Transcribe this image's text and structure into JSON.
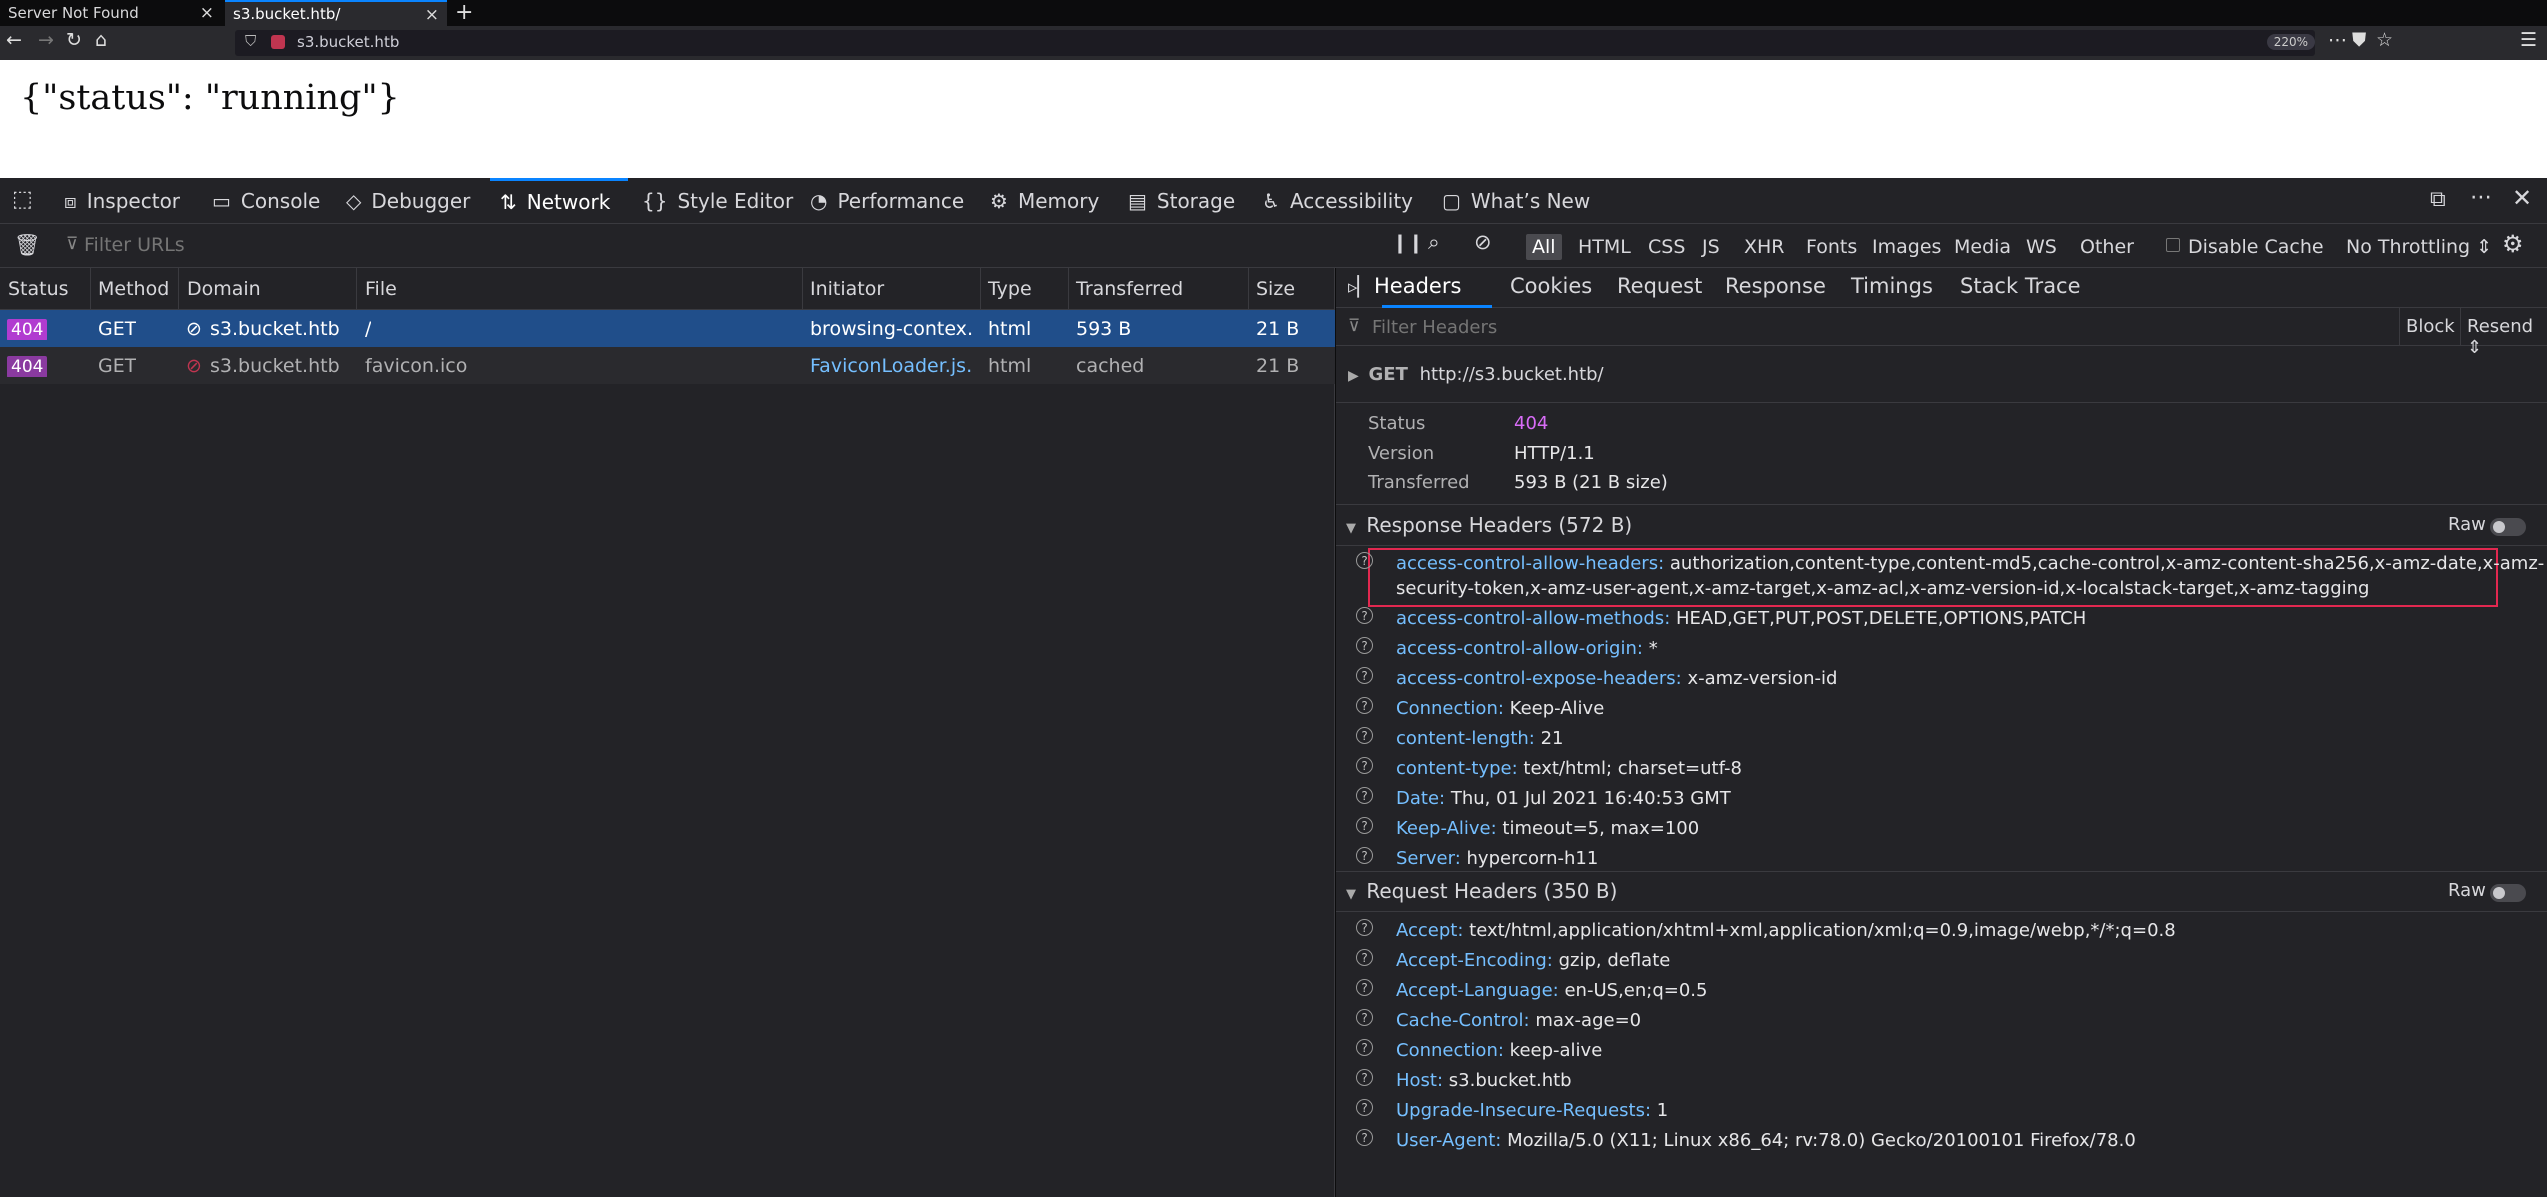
{
  "tabs": [
    {
      "label": "Server Not Found"
    },
    {
      "label": "s3.bucket.htb/"
    }
  ],
  "navbar": {
    "url": "s3.bucket.htb",
    "zoom": "220%"
  },
  "page": {
    "content": "{\"status\": \"running\"}"
  },
  "devtools": {
    "tabs": [
      "Inspector",
      "Console",
      "Debugger",
      "Network",
      "Style Editor",
      "Performance",
      "Memory",
      "Storage",
      "Accessibility",
      "What’s New"
    ],
    "filter_placeholder": "Filter URLs",
    "type_filters": [
      "All",
      "HTML",
      "CSS",
      "JS",
      "XHR",
      "Fonts",
      "Images",
      "Media",
      "WS",
      "Other"
    ],
    "disable_cache": "Disable Cache",
    "throttling": "No Throttling"
  },
  "requests": {
    "columns": [
      "Status",
      "Method",
      "Domain",
      "File",
      "Initiator",
      "Type",
      "Transferred",
      "Size"
    ],
    "rows": [
      {
        "status": "404",
        "method": "GET",
        "domain": "s3.bucket.htb",
        "file": "/",
        "initiator": "browsing-contex…",
        "type": "html",
        "transferred": "593 B",
        "size": "21 B"
      },
      {
        "status": "404",
        "method": "GET",
        "domain": "s3.bucket.htb",
        "file": "favicon.ico",
        "initiator": "FaviconLoader.js…",
        "type": "html",
        "transferred": "cached",
        "size": "21 B"
      }
    ]
  },
  "details": {
    "tabs": [
      "Headers",
      "Cookies",
      "Request",
      "Response",
      "Timings",
      "Stack Trace"
    ],
    "filter_placeholder": "Filter Headers",
    "block_label": "Block",
    "resend_label": "Resend",
    "request_line": {
      "method": "GET",
      "url": "http://s3.bucket.htb/"
    },
    "summary": [
      {
        "label": "Status",
        "value": "404"
      },
      {
        "label": "Version",
        "value": "HTTP/1.1"
      },
      {
        "label": "Transferred",
        "value": "593 B (21 B size)"
      }
    ],
    "response_headers_title": "Response Headers (572 B)",
    "request_headers_title": "Request Headers (350 B)",
    "raw_label": "Raw",
    "response_headers": [
      {
        "name": "access-control-allow-headers:",
        "value": "authorization,content-type,content-md5,cache-control,x-amz-content-sha256,x-amz-date,x-amz-",
        "value2": "security-token,x-amz-user-agent,x-amz-target,x-amz-acl,x-amz-version-id,x-localstack-target,x-amz-tagging"
      },
      {
        "name": "access-control-allow-methods:",
        "value": "HEAD,GET,PUT,POST,DELETE,OPTIONS,PATCH"
      },
      {
        "name": "access-control-allow-origin:",
        "value": "*"
      },
      {
        "name": "access-control-expose-headers:",
        "value": "x-amz-version-id"
      },
      {
        "name": "Connection:",
        "value": "Keep-Alive"
      },
      {
        "name": "content-length:",
        "value": "21"
      },
      {
        "name": "content-type:",
        "value": "text/html; charset=utf-8"
      },
      {
        "name": "Date:",
        "value": "Thu, 01 Jul 2021 16:40:53 GMT"
      },
      {
        "name": "Keep-Alive:",
        "value": "timeout=5, max=100"
      },
      {
        "name": "Server:",
        "value": "hypercorn-h11"
      }
    ],
    "request_headers": [
      {
        "name": "Accept:",
        "value": "text/html,application/xhtml+xml,application/xml;q=0.9,image/webp,*/*;q=0.8"
      },
      {
        "name": "Accept-Encoding:",
        "value": "gzip, deflate"
      },
      {
        "name": "Accept-Language:",
        "value": "en-US,en;q=0.5"
      },
      {
        "name": "Cache-Control:",
        "value": "max-age=0"
      },
      {
        "name": "Connection:",
        "value": "keep-alive"
      },
      {
        "name": "Host:",
        "value": "s3.bucket.htb"
      },
      {
        "name": "Upgrade-Insecure-Requests:",
        "value": "1"
      },
      {
        "name": "User-Agent:",
        "value": "Mozilla/5.0 (X11; Linux x86_64; rv:78.0) Gecko/20100101 Firefox/78.0"
      }
    ]
  },
  "colors": {
    "accent": "#0a84ff",
    "status_404": "#b13cd0",
    "highlight_box": "#e22850"
  }
}
